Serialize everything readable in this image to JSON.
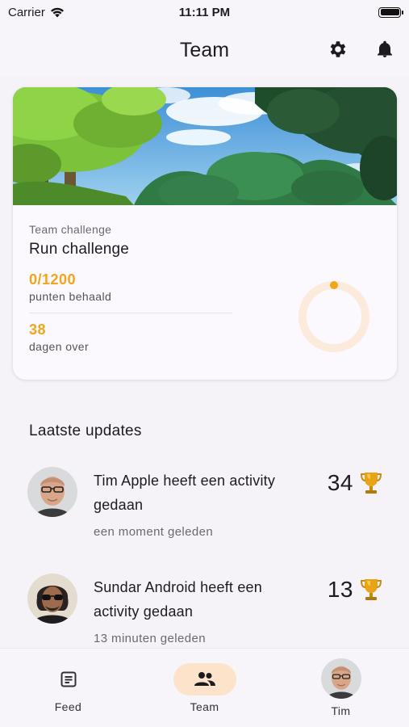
{
  "status_bar": {
    "carrier": "Carrier",
    "time": "11:11 PM"
  },
  "app_bar": {
    "title": "Team",
    "settings_icon": "gear-icon",
    "notifications_icon": "bell-icon"
  },
  "challenge": {
    "kicker": "Team challenge",
    "title": "Run challenge",
    "points_value": "0/1200",
    "points_label": "punten behaald",
    "days_value": "38",
    "days_label": "dagen over",
    "progress": 0,
    "accent_color": "#f0a51a"
  },
  "updates": {
    "title": "Laatste updates",
    "items": [
      {
        "text": "Tim Apple heeft een activity gedaan",
        "time": "een moment geleden",
        "score": "34",
        "icon": "trophy-icon"
      },
      {
        "text": "Sundar Android heeft een activity gedaan",
        "time": "13 minuten geleden",
        "score": "13",
        "icon": "trophy-icon"
      }
    ]
  },
  "bottom_nav": {
    "items": [
      {
        "label": "Feed",
        "icon": "article-icon"
      },
      {
        "label": "Team",
        "icon": "group-icon",
        "active": true
      },
      {
        "label": "Tim",
        "icon": "avatar"
      }
    ],
    "active_color": "#fde3c9"
  }
}
